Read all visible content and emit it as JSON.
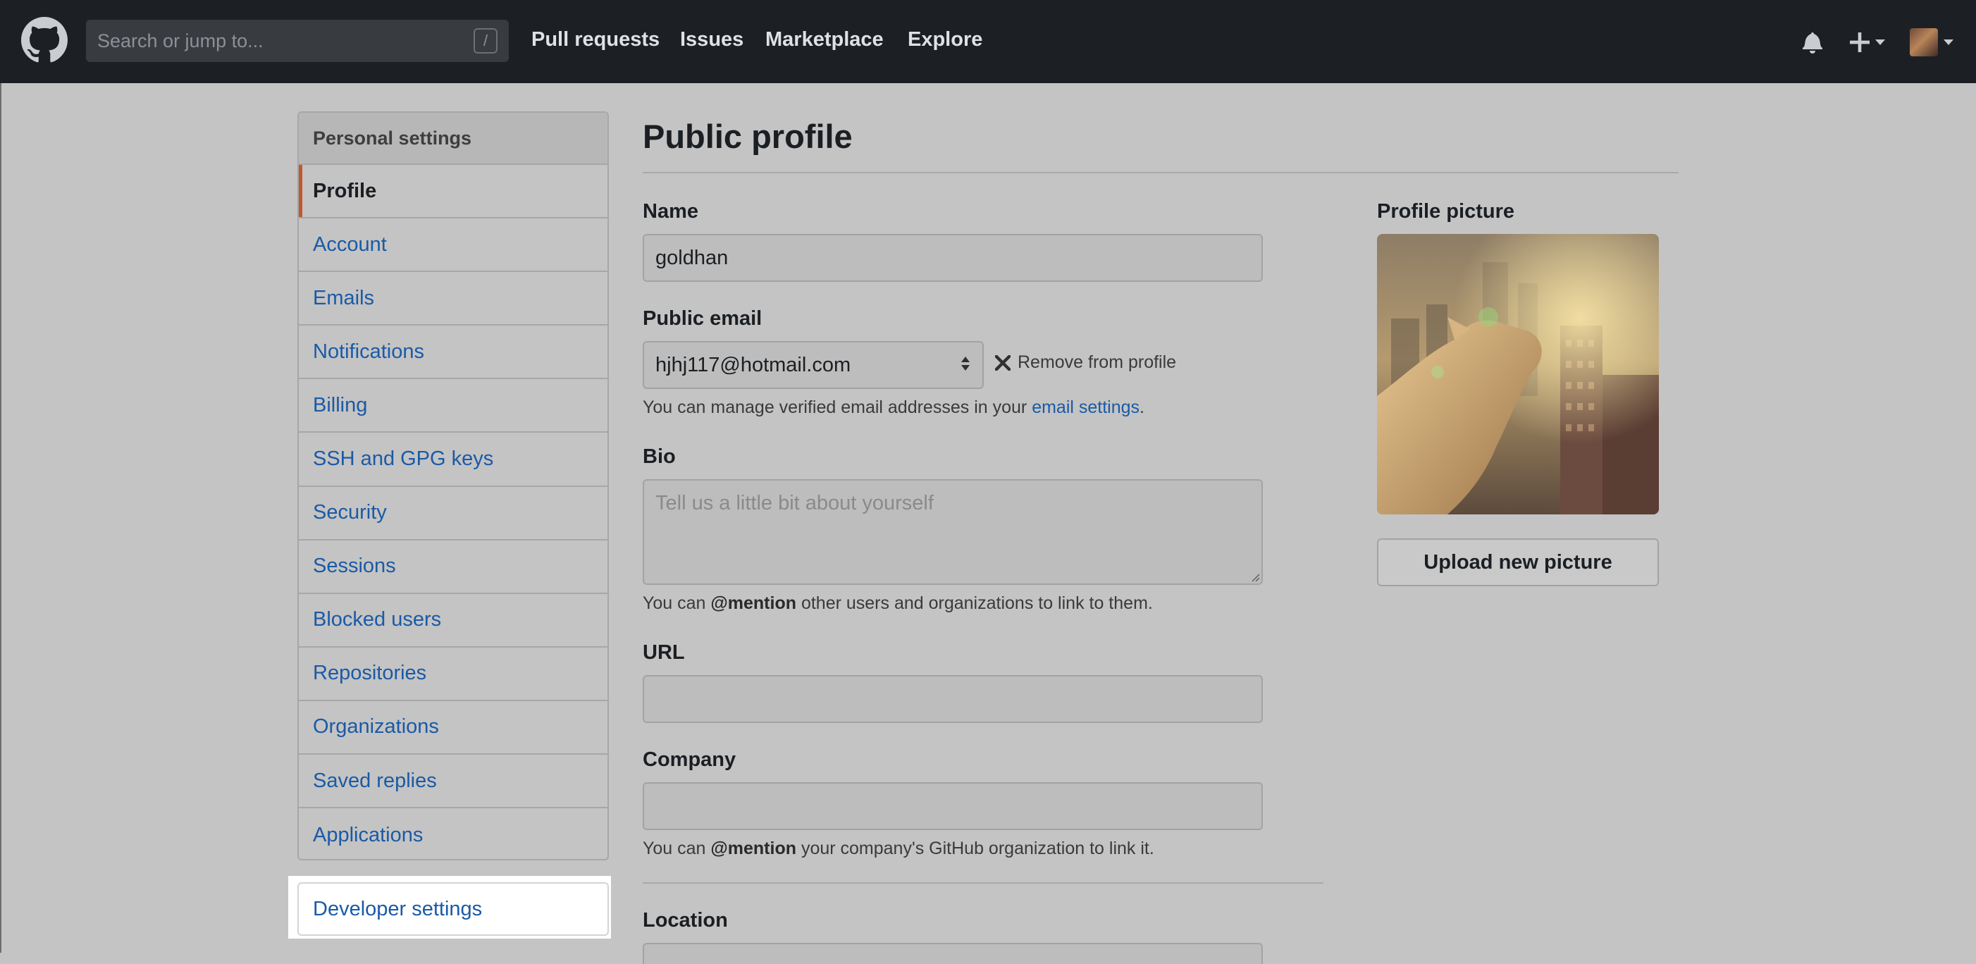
{
  "header": {
    "search_placeholder": "Search or jump to...",
    "search_key": "/",
    "nav": [
      "Pull requests",
      "Issues",
      "Marketplace",
      "Explore"
    ],
    "icons": [
      "github-logo-icon",
      "bell-icon",
      "plus-icon",
      "avatar"
    ]
  },
  "sidebar": {
    "heading": "Personal settings",
    "items": [
      {
        "label": "Profile",
        "active": true
      },
      {
        "label": "Account"
      },
      {
        "label": "Emails"
      },
      {
        "label": "Notifications"
      },
      {
        "label": "Billing"
      },
      {
        "label": "SSH and GPG keys"
      },
      {
        "label": "Security"
      },
      {
        "label": "Sessions"
      },
      {
        "label": "Blocked users"
      },
      {
        "label": "Repositories"
      },
      {
        "label": "Organizations"
      },
      {
        "label": "Saved replies"
      },
      {
        "label": "Applications"
      }
    ],
    "developer_settings": "Developer settings"
  },
  "main": {
    "title": "Public profile",
    "name_label": "Name",
    "name_value": "goldhan",
    "email_label": "Public email",
    "email_value": "hjhj117@hotmail.com",
    "remove_label": "Remove from profile",
    "email_note_prefix": "You can manage verified email addresses in your ",
    "email_note_link": "email settings",
    "email_note_suffix": ".",
    "bio_label": "Bio",
    "bio_placeholder": "Tell us a little bit about yourself",
    "bio_note_prefix": "You can ",
    "bio_note_bold": "@mention",
    "bio_note_suffix": " other users and organizations to link to them.",
    "url_label": "URL",
    "url_value": "",
    "company_label": "Company",
    "company_value": "",
    "company_note_prefix": "You can ",
    "company_note_bold": "@mention",
    "company_note_suffix": " your company's GitHub organization to link it.",
    "location_label": "Location",
    "picture_label": "Profile picture",
    "upload_label": "Upload new picture"
  },
  "colors": {
    "header_bg": "#1c2025",
    "link": "#1a5aa6",
    "active_marker": "#c0582e",
    "overlay_bg": "#c4c4c4"
  }
}
